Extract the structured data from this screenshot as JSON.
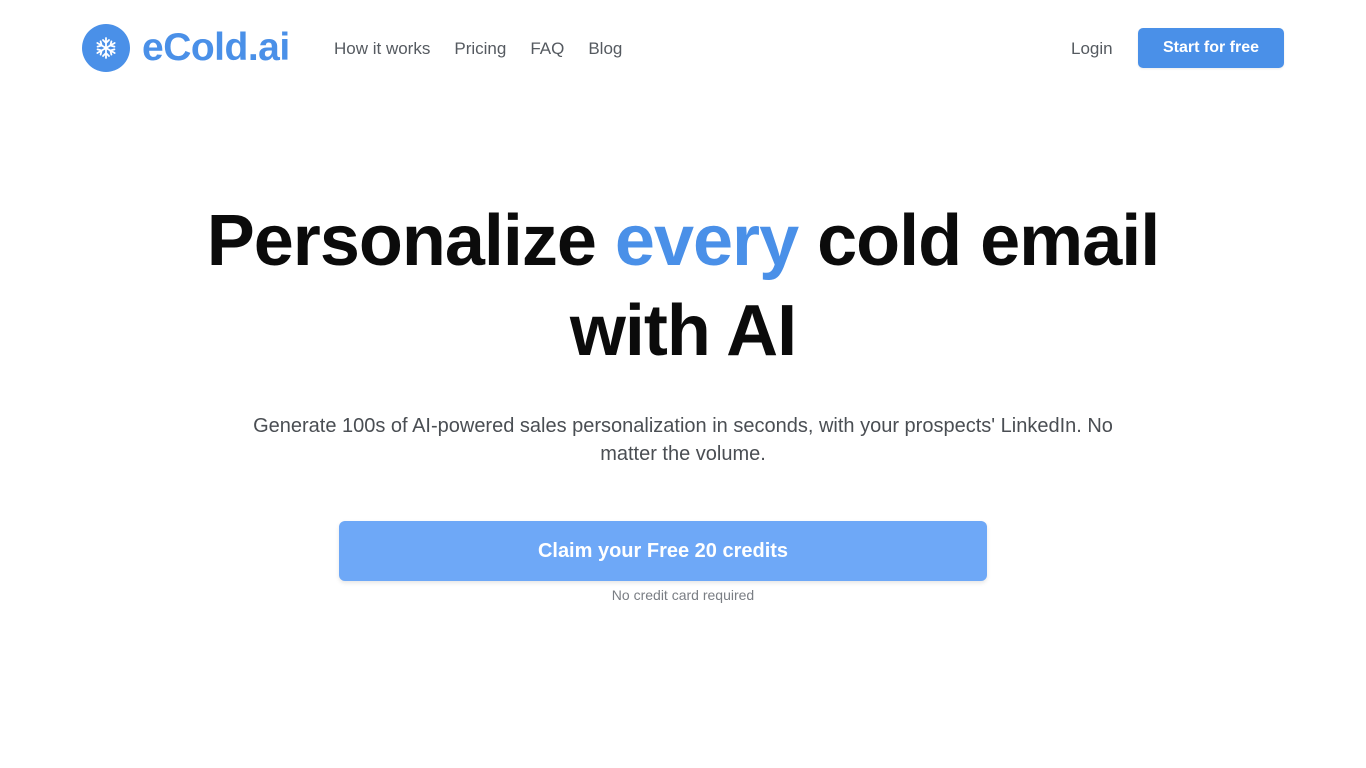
{
  "header": {
    "logo_text": "eCold.ai",
    "logo_icon": "snowflake-icon",
    "nav": [
      {
        "label": "How it works"
      },
      {
        "label": "Pricing"
      },
      {
        "label": "FAQ"
      },
      {
        "label": "Blog"
      }
    ],
    "login_label": "Login",
    "start_label": "Start for free"
  },
  "hero": {
    "title_part1": "Personalize ",
    "title_accent": "every",
    "title_part2": " cold email",
    "title_line2": "with AI",
    "subtitle": "Generate 100s of AI-powered sales personalization in seconds, with your prospects' LinkedIn. No matter the volume.",
    "cta_label": "Claim your Free 20 credits",
    "cta_note": "No credit card required"
  },
  "colors": {
    "brand": "#4a90e8",
    "cta": "#6ea8f7",
    "text": "#0b0b0b",
    "muted": "#7a7e84"
  }
}
